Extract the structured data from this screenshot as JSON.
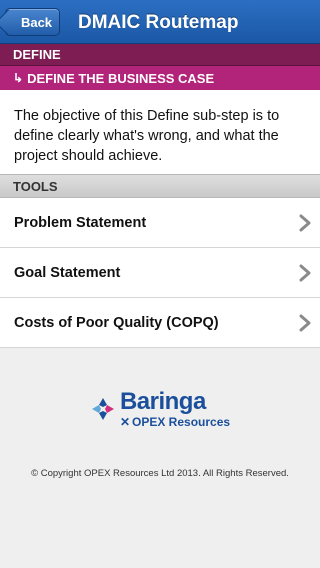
{
  "navbar": {
    "back_label": "Back",
    "title": "DMAIC Routemap"
  },
  "section": {
    "label": "DEFINE",
    "sub_label": "DEFINE THE BUSINESS CASE"
  },
  "description": "The objective of this Define sub-step is to define clearly what's wrong, and what the project should achieve.",
  "tools": {
    "header": "TOOLS",
    "items": [
      {
        "label": "Problem Statement"
      },
      {
        "label": "Goal Statement"
      },
      {
        "label": "Costs of Poor Quality (COPQ)"
      }
    ]
  },
  "footer": {
    "logo_name": "Baringa",
    "logo_sub": "OPEX Resources",
    "copyright": "© Copyright OPEX Resources Ltd 2013. All Rights Reserved."
  },
  "colors": {
    "nav_blue": "#1b58a6",
    "section_purple": "#7e1d53",
    "sub_magenta": "#b1247a"
  }
}
